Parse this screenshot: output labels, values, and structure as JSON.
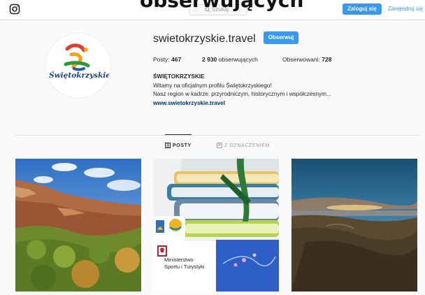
{
  "overlay_title": "obserwujących",
  "topbar": {
    "search_placeholder": "Szukaj",
    "login_label": "Zaloguj się",
    "signup_label": "Zarejestruj się"
  },
  "profile": {
    "avatar_text": "Świętokrzyskie",
    "username": "swietokrzyskie.travel",
    "follow_label": "Obserwuj",
    "stats": {
      "posts_label": "Posty:",
      "posts_value": "467",
      "followers_value": "2 930",
      "followers_label": "obserwujących",
      "following_label": "Obserwowani:",
      "following_value": "728"
    },
    "bio": {
      "name": "ŚWIĘTOKRZYSKIE",
      "line1": "Witamy na oficjalnym profilu Świętokrzyskiego!",
      "line2": "Nasz region w kadrze: przyrodniczym, historycznym i współczesnym...",
      "link": "www.swietokrzyskie.travel"
    }
  },
  "tabs": {
    "posts": "POSTY",
    "tagged": "Z OZNACZENIEM"
  },
  "grid": {
    "post2_ministry_line1": "Ministerstwo",
    "post2_ministry_line2": "Sportu i Turystyki"
  },
  "colors": {
    "accent": "#3897f0",
    "link": "#003569",
    "border": "#dbdbdb"
  }
}
